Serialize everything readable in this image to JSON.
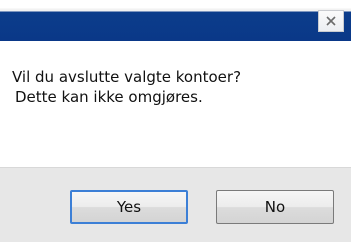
{
  "window": {
    "close_icon": "close-icon",
    "title_bar_color": "#0a3888"
  },
  "message": {
    "line1": "Vil du avslutte valgte kontoer?",
    "line2": "Dette kan ikke omgjøres."
  },
  "buttons": {
    "yes_label": "Yes",
    "no_label": "No",
    "default_focus_color": "#3c7fd6"
  }
}
